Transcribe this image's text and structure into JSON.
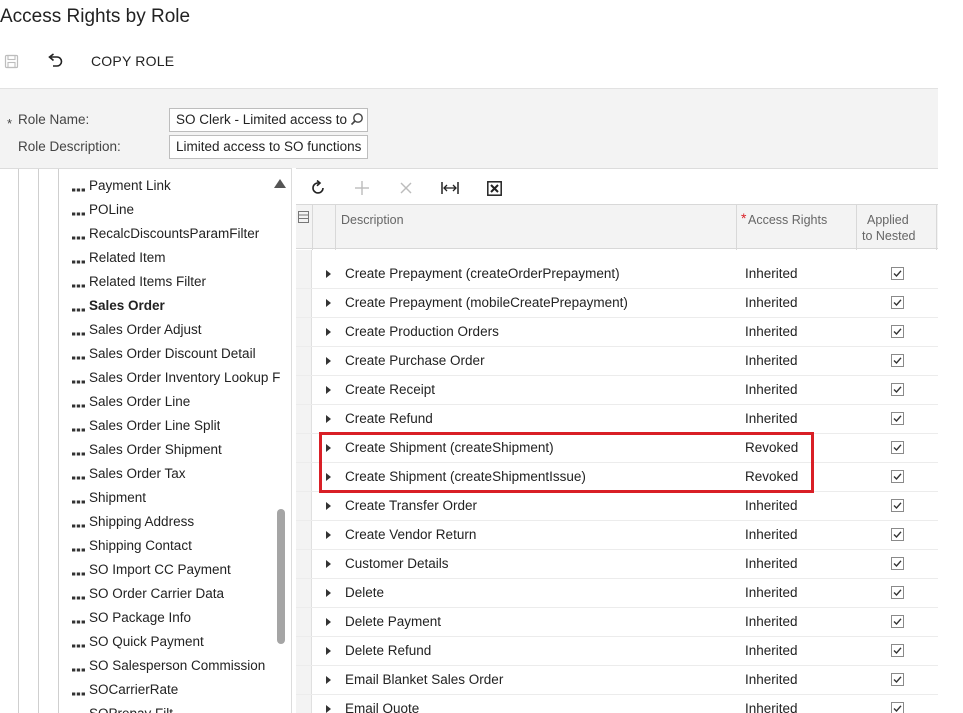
{
  "page": {
    "title": "Access Rights by Role"
  },
  "toolbar": {
    "copy_role_label": "COPY ROLE"
  },
  "form": {
    "role_name_label": "Role Name:",
    "role_name_required": "*",
    "role_name_value": "SO Clerk - Limited access to SO functions",
    "role_description_label": "Role Description:",
    "role_description_value": "Limited access to SO functions"
  },
  "tree": {
    "items": [
      {
        "label": "Payment Link",
        "bold": false
      },
      {
        "label": "POLine",
        "bold": false
      },
      {
        "label": "RecalcDiscountsParamFilter",
        "bold": false
      },
      {
        "label": "Related Item",
        "bold": false
      },
      {
        "label": "Related Items Filter",
        "bold": false
      },
      {
        "label": "Sales Order",
        "bold": true
      },
      {
        "label": "Sales Order Adjust",
        "bold": false
      },
      {
        "label": "Sales Order Discount Detail",
        "bold": false
      },
      {
        "label": "Sales Order Inventory Lookup F",
        "bold": false
      },
      {
        "label": "Sales Order Line",
        "bold": false
      },
      {
        "label": "Sales Order Line Split",
        "bold": false
      },
      {
        "label": "Sales Order Shipment",
        "bold": false
      },
      {
        "label": "Sales Order Tax",
        "bold": false
      },
      {
        "label": "Shipment",
        "bold": false
      },
      {
        "label": "Shipping Address",
        "bold": false
      },
      {
        "label": "Shipping Contact",
        "bold": false
      },
      {
        "label": "SO Import CC Payment",
        "bold": false
      },
      {
        "label": "SO Order Carrier Data",
        "bold": false
      },
      {
        "label": "SO Package Info",
        "bold": false
      },
      {
        "label": "SO Quick Payment",
        "bold": false
      },
      {
        "label": "SO Salesperson Commission",
        "bold": false
      },
      {
        "label": "SOCarrierRate",
        "bold": false
      },
      {
        "label": "SOPrepay Filt",
        "bold": false
      }
    ]
  },
  "grid": {
    "columns": {
      "description": "Description",
      "access_rights_required": "*",
      "access_rights": "Access Rights",
      "applied_line1": "Applied",
      "applied_line2": "to Nested"
    },
    "rows": [
      {
        "description": "Create Prepayment (createOrderPrepayment)",
        "rights": "Inherited"
      },
      {
        "description": "Create Prepayment (mobileCreatePrepayment)",
        "rights": "Inherited"
      },
      {
        "description": "Create Production Orders",
        "rights": "Inherited"
      },
      {
        "description": "Create Purchase Order",
        "rights": "Inherited"
      },
      {
        "description": "Create Receipt",
        "rights": "Inherited"
      },
      {
        "description": "Create Refund",
        "rights": "Inherited"
      },
      {
        "description": "Create Shipment (createShipment)",
        "rights": "Revoked"
      },
      {
        "description": "Create Shipment (createShipmentIssue)",
        "rights": "Revoked"
      },
      {
        "description": "Create Transfer Order",
        "rights": "Inherited"
      },
      {
        "description": "Create Vendor Return",
        "rights": "Inherited"
      },
      {
        "description": "Customer Details",
        "rights": "Inherited"
      },
      {
        "description": "Delete",
        "rights": "Inherited"
      },
      {
        "description": "Delete Payment",
        "rights": "Inherited"
      },
      {
        "description": "Delete Refund",
        "rights": "Inherited"
      },
      {
        "description": "Email Blanket Sales Order",
        "rights": "Inherited"
      },
      {
        "description": "Email Quote",
        "rights": "Inherited"
      }
    ]
  },
  "colors": {
    "highlight": "#d91f26",
    "header_bg": "#f3f3f3"
  }
}
